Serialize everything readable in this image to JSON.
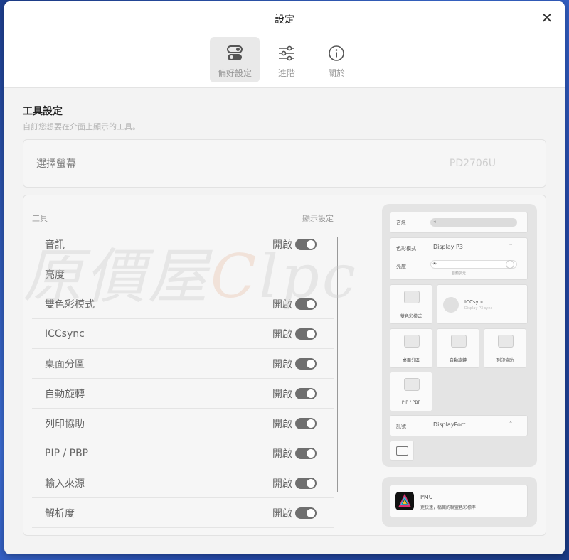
{
  "window": {
    "title": "設定",
    "close_icon": "close-icon"
  },
  "tabs": [
    {
      "label": "偏好設定",
      "icon": "toggles-icon",
      "active": true
    },
    {
      "label": "進階",
      "icon": "sliders-icon",
      "active": false
    },
    {
      "label": "關於",
      "icon": "info-icon",
      "active": false
    }
  ],
  "section": {
    "title": "工具設定",
    "subtitle": "自訂您想要在介面上顯示的工具。"
  },
  "screen_select": {
    "label": "選擇螢幕",
    "value": "PD2706U"
  },
  "tool_table": {
    "col_tool": "工具",
    "col_display": "顯示設定",
    "rows": [
      {
        "name": "音訊",
        "state": "開啟",
        "toggle": true
      },
      {
        "name": "亮度",
        "state": "",
        "toggle": false
      },
      {
        "name": "雙色彩模式",
        "state": "開啟",
        "toggle": true
      },
      {
        "name": "ICCsync",
        "state": "開啟",
        "toggle": true
      },
      {
        "name": "桌面分區",
        "state": "開啟",
        "toggle": true
      },
      {
        "name": "自動旋轉",
        "state": "開啟",
        "toggle": true
      },
      {
        "name": "列印協助",
        "state": "開啟",
        "toggle": true
      },
      {
        "name": "PIP / PBP",
        "state": "開啟",
        "toggle": true
      },
      {
        "name": "輸入來源",
        "state": "開啟",
        "toggle": true
      },
      {
        "name": "解析度",
        "state": "開啟",
        "toggle": true
      }
    ]
  },
  "preview": {
    "audio_label": "音訊",
    "color_mode_label": "色彩模式",
    "color_mode_value": "Display P3",
    "brightness_label": "亮度",
    "brightness_sub": "自動調光",
    "dual_color_label": "雙色彩模式",
    "iccsync_label": "ICCsync",
    "iccsync_sub": "Display P3 sync",
    "desktop_partition_label": "桌面分區",
    "auto_rotate_label": "自動旋轉",
    "print_assist_label": "列印協助",
    "pip_label": "PIP / PBP",
    "input_label": "訊號",
    "input_value": "DisplayPort",
    "pmu_title": "PMU",
    "pmu_sub": "更快速，稱職的聯盟色彩標準"
  },
  "watermark": {
    "text": "原價屋",
    "latin_c": "C",
    "latin_rest": "lpc"
  },
  "colors": {
    "toggle_on": "#6f6f6f",
    "panel_bg": "#f3f3f3"
  }
}
